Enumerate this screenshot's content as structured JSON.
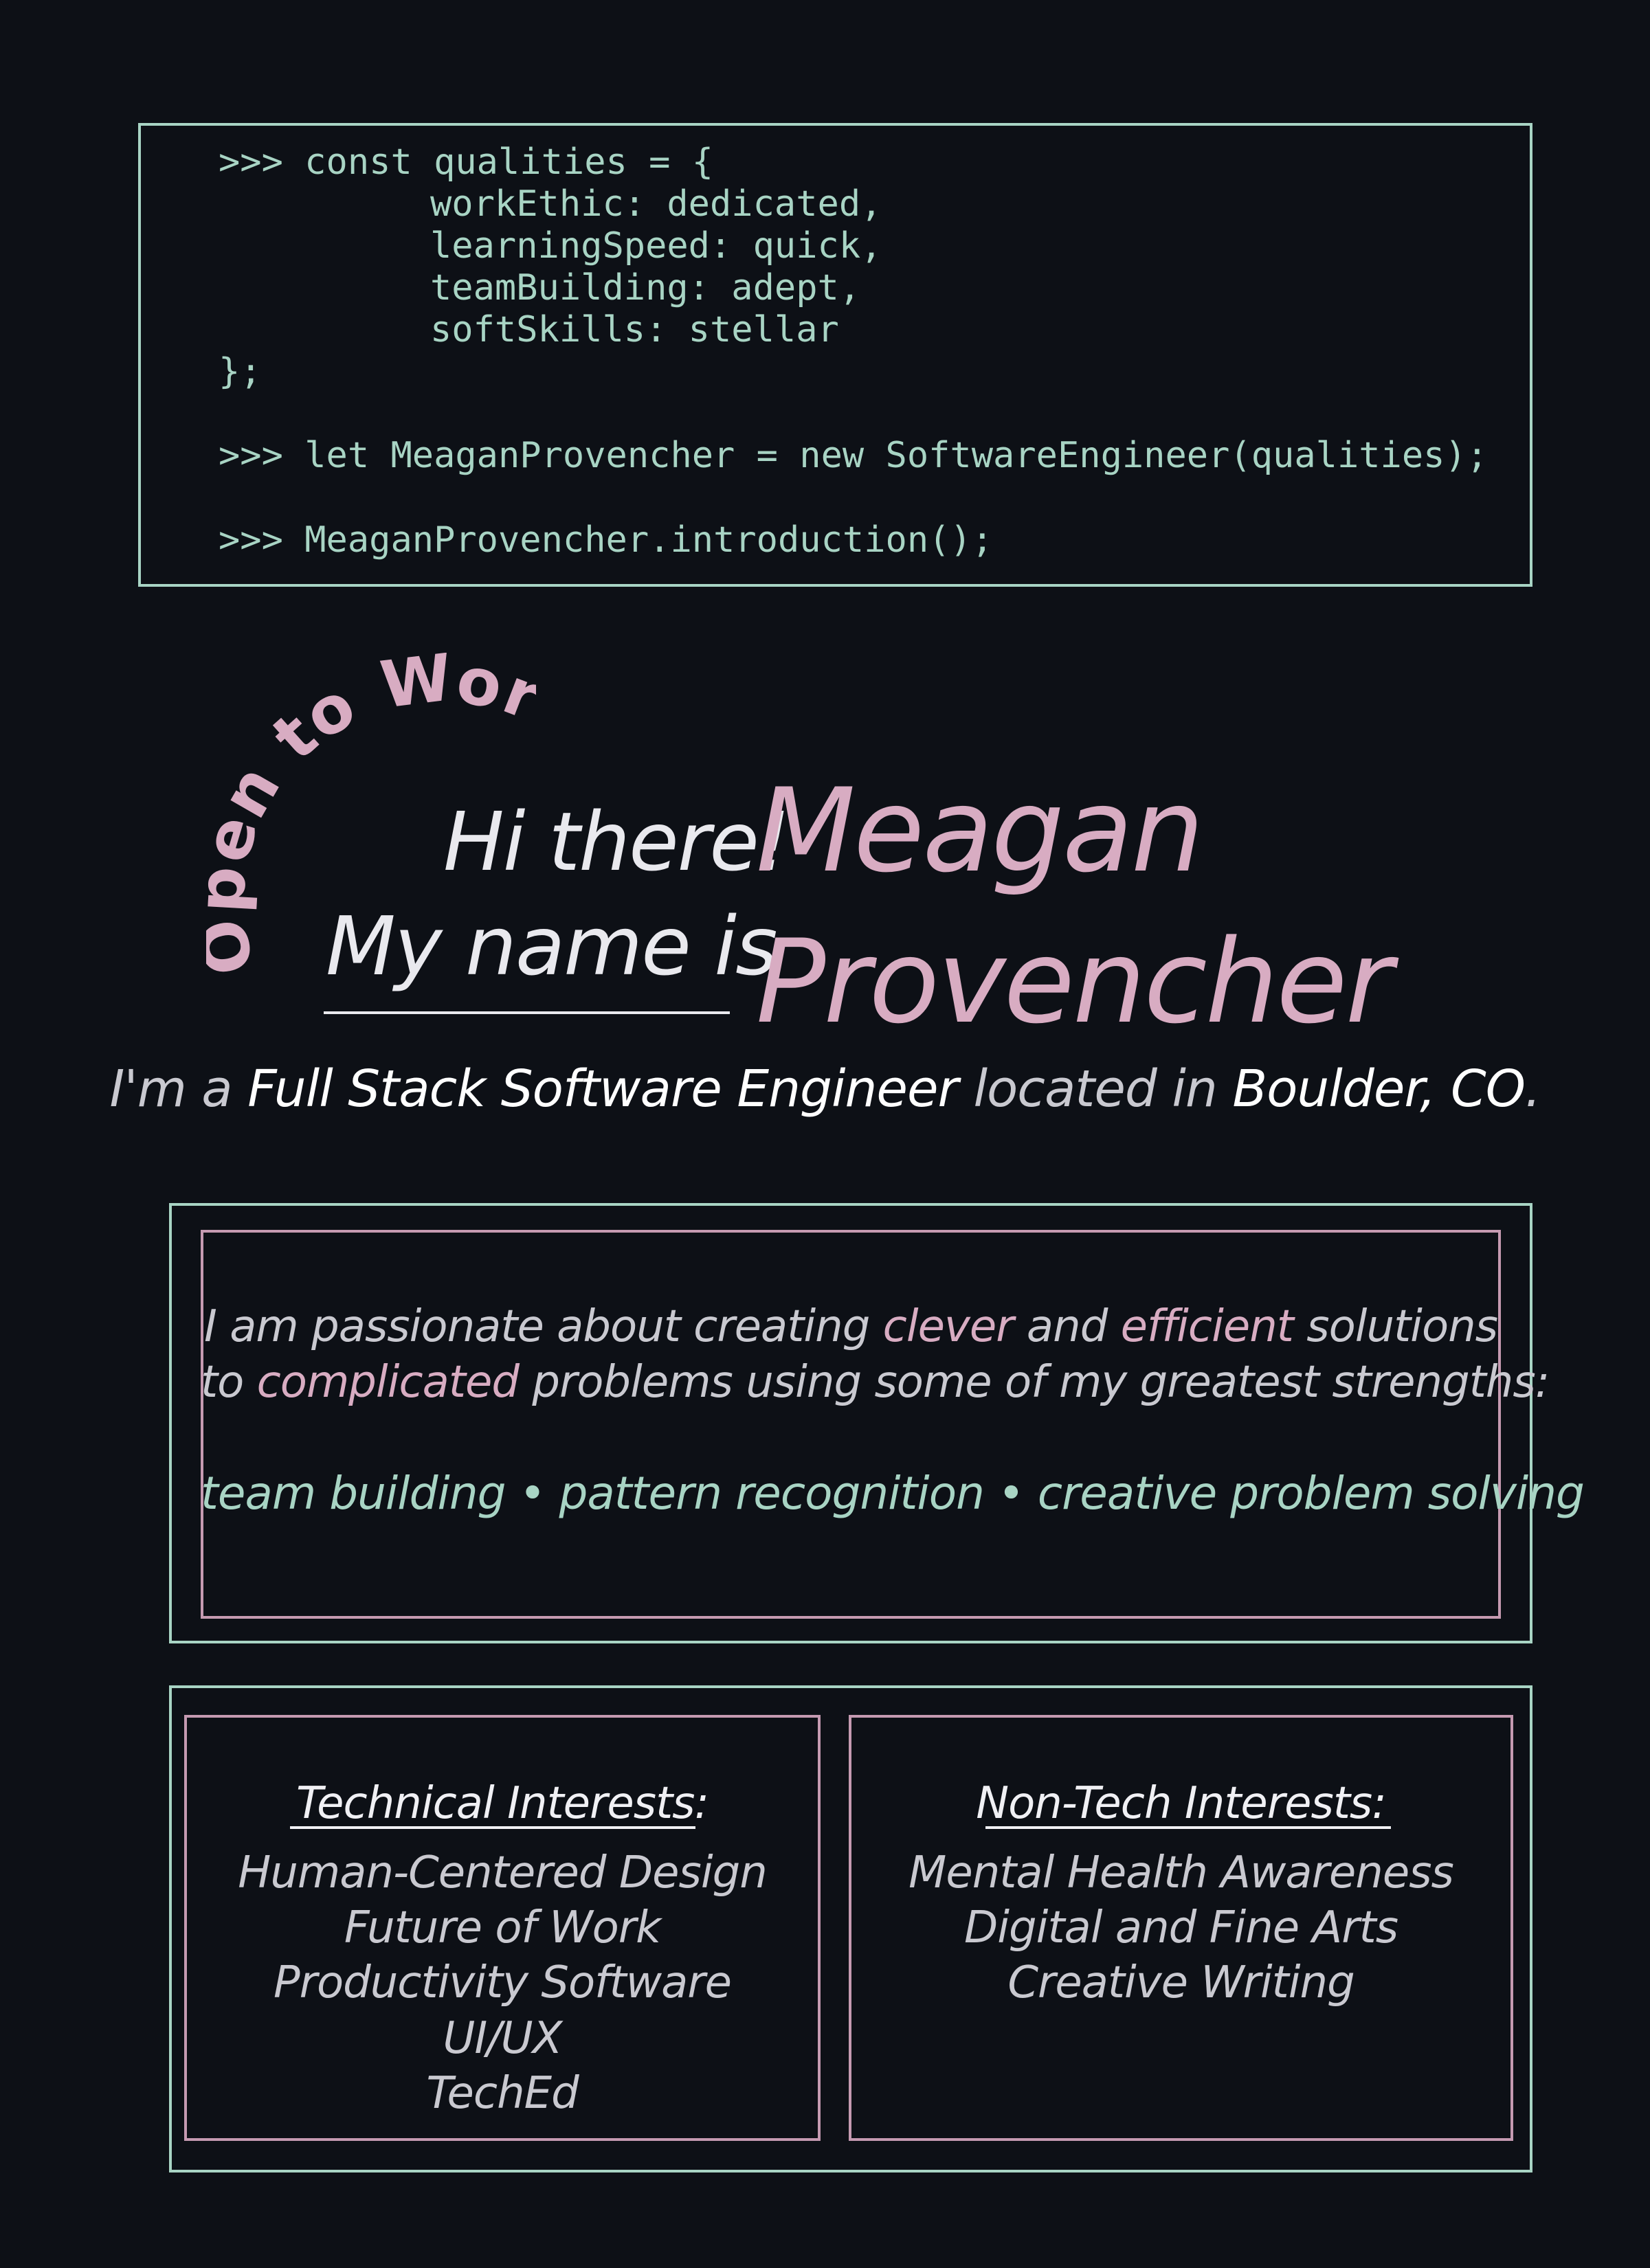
{
  "code": {
    "line1": ">>> const qualities = {",
    "line2": "workEthic: dedicated,",
    "line3": "learningSpeed: quick,",
    "line4": "teamBuilding: adept,",
    "line5": "softSkills: stellar",
    "line6": "};",
    "line7": ">>> let MeaganProvencher = new SoftwareEngineer(qualities);",
    "line8": ">>> MeaganProvencher.introduction();"
  },
  "hero": {
    "badge": "Open to Work",
    "greeting": "Hi there!",
    "name_intro": "My name is",
    "first_name": "Meagan",
    "last_name": "Provencher"
  },
  "tagline": {
    "prefix": "I'm a ",
    "role": "Full Stack Software Engineer",
    "middle": " located in ",
    "location": "Boulder, CO",
    "suffix": "."
  },
  "passion": {
    "l1_a": "I am passionate about creating ",
    "l1_b": "clever",
    "l1_c": " and ",
    "l1_d": "efficient",
    "l1_e": " solutions",
    "l2_a": "to ",
    "l2_b": "complicated",
    "l2_c": " problems using some of my greatest strengths:",
    "strengths": "team building • pattern recognition • creative problem solving"
  },
  "technical": {
    "heading": "Technical Interests:",
    "items": [
      "Human-Centered Design",
      "Future of Work",
      "Productivity Software",
      "UI/UX",
      "TechEd"
    ]
  },
  "nontech": {
    "heading": "Non-Tech Interests:",
    "items": [
      "Mental Health Awareness",
      "Digital and Fine Arts",
      "Creative Writing"
    ]
  },
  "colors": {
    "background": "#0d1016",
    "mint": "#a8d4c4",
    "pink": "#d8acc2",
    "text": "#e9e9ee"
  }
}
